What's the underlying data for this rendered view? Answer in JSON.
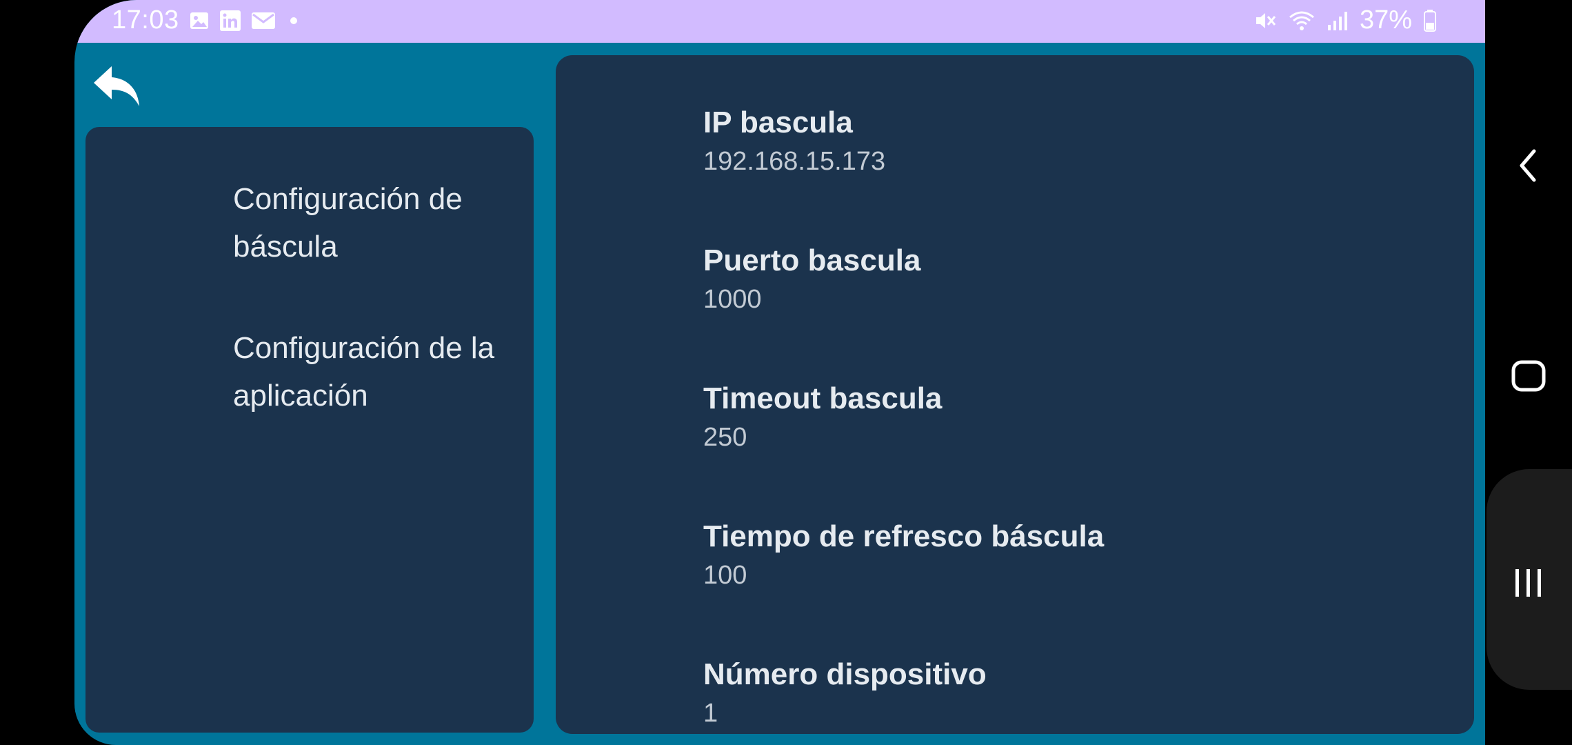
{
  "status_bar": {
    "time": "17:03",
    "left_icons": [
      "image-icon",
      "linkedin-icon",
      "mail-icon",
      "dot-icon"
    ],
    "right_icons": [
      "mute-icon",
      "wifi-icon",
      "signal-icon"
    ],
    "battery_text": "37%"
  },
  "toolbar": {
    "back_icon": "reply-arrow-icon"
  },
  "sidebar": {
    "items": [
      {
        "label": "Configuración de báscula"
      },
      {
        "label": "Configuración de la aplicación"
      }
    ]
  },
  "preferences": [
    {
      "title": "IP bascula",
      "value": "192.168.15.173"
    },
    {
      "title": "Puerto bascula",
      "value": "1000"
    },
    {
      "title": "Timeout bascula",
      "value": "250"
    },
    {
      "title": "Tiempo de refresco báscula",
      "value": "100"
    },
    {
      "title": "Número dispositivo",
      "value": "1"
    }
  ],
  "system_nav": {
    "back_icon": "chevron-left-icon",
    "home_icon": "home-square-icon",
    "recents_icon": "recents-bars-icon"
  },
  "colors": {
    "status_bar": "#d2bbff",
    "background": "#00759a",
    "panel": "#1b334d"
  }
}
